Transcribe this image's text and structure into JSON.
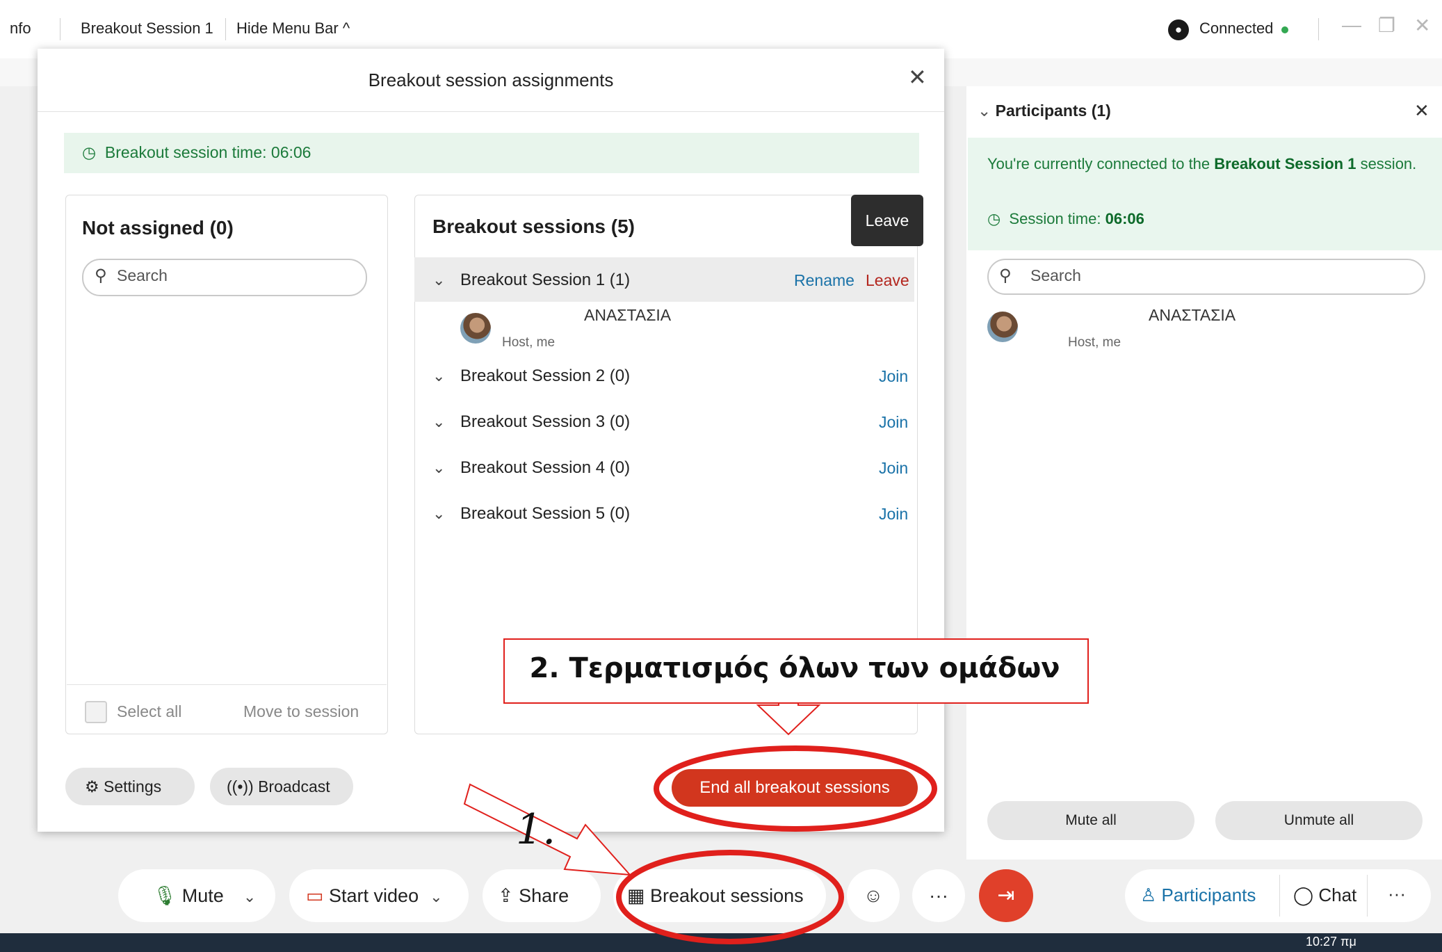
{
  "window": {
    "menu_items": [
      "nfo",
      "Breakout Session 1",
      "Hide Menu Bar ^"
    ],
    "connection_status": "Connected",
    "controls": [
      "—",
      "❐",
      "✕"
    ]
  },
  "modal": {
    "title": "Breakout session assignments",
    "time_banner": "Breakout session time: 06:06",
    "not_assigned": {
      "title": "Not assigned (0)",
      "search_placeholder": "Search",
      "select_all": "Select all",
      "move_to_session": "Move to session"
    },
    "breakout_sessions": {
      "title": "Breakout sessions  (5)",
      "tooltip": "Leave",
      "sessions": [
        {
          "label": "Breakout Session 1 (1)",
          "actions": [
            "Rename",
            "Leave"
          ]
        },
        {
          "label": "Breakout Session 2 (0)",
          "action": "Join"
        },
        {
          "label": "Breakout Session 3 (0)",
          "action": "Join"
        },
        {
          "label": "Breakout Session 4 (0)",
          "action": "Join"
        },
        {
          "label": "Breakout Session 5 (0)",
          "action": "Join"
        }
      ],
      "member": {
        "name": "ΑΝΑΣΤΑΣΙΑ",
        "role": "Host, me"
      }
    },
    "settings_label": "Settings",
    "broadcast_label": "Broadcast",
    "end_all_label": "End all breakout sessions"
  },
  "participants_panel": {
    "title": "Participants (1)",
    "banner_prefix": "You're currently connected to the ",
    "banner_session": "Breakout Session 1",
    "banner_suffix": " session.",
    "session_time_label": "Session time: ",
    "session_time_value": "06:06",
    "search_placeholder": "Search",
    "participant": {
      "name": "ΑΝΑΣΤΑΣΙΑ",
      "role": "Host, me"
    },
    "mute_all": "Mute all",
    "unmute_all": "Unmute all"
  },
  "toolbar": {
    "mute": "Mute",
    "start_video": "Start video",
    "share": "Share",
    "breakout_sessions": "Breakout sessions",
    "more": "···",
    "participants": "Participants",
    "chat": "Chat"
  },
  "taskbar": {
    "clock": "10:27 πμ"
  },
  "annotations": {
    "step2": "2. Τερματισμός όλων των ομάδων",
    "step1": "1."
  },
  "colors": {
    "accent_green": "#1b7a3a",
    "end_button": "#d2361e",
    "link_blue": "#1a72a8",
    "annotation_red": "#e0201c"
  }
}
